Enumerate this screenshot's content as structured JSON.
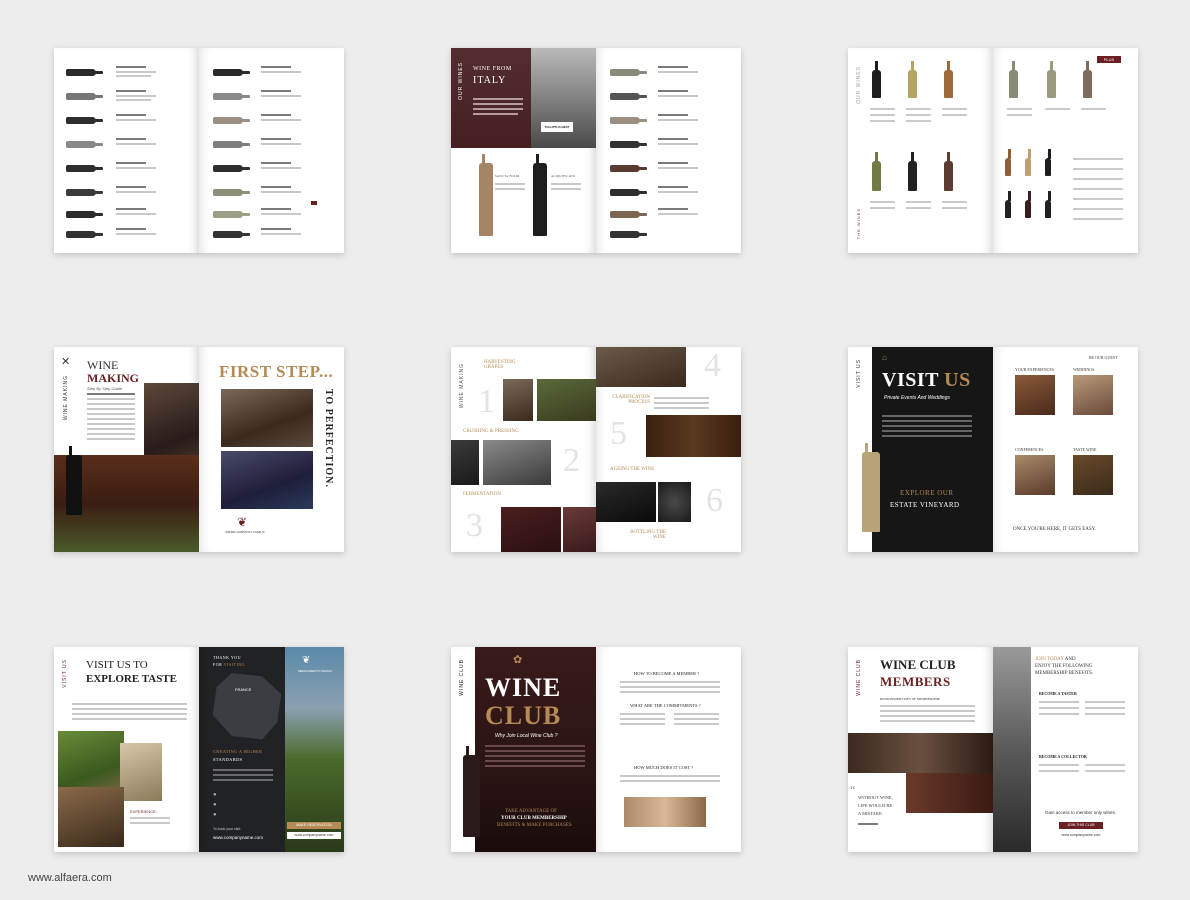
{
  "footer_url": "www.alfaera.com",
  "spread2": {
    "wine_from": "WINE FROM",
    "italy": "ITALY",
    "side_label": "OUR WINES",
    "sticker": "TOLUPTUA DEST",
    "bottle1": "SANCTA FOLIR",
    "bottle2": "ALIQUIFICATO"
  },
  "spread3": {
    "side_label": "OUR WINES",
    "tag": "PLUS",
    "side_label2": "THE WINES"
  },
  "spread4": {
    "title1": "WINE",
    "title2": "MAKING",
    "subtitle": "Step By Step Guide",
    "side_label": "WINE MAKING",
    "first_step": "FIRST STEP...",
    "to_perfection": "TO PERFECTION.",
    "brand": "MEDICAMENTO SAMUS"
  },
  "spread5": {
    "side_label": "WINE MAKING",
    "steps": [
      "HARVESTING GRAPES",
      "CRUSHING & PRESSING",
      "FERMENTATION",
      "CLARIFICATION PROCESS",
      "AGEING THE WINE",
      "BOTTLING THE WINE"
    ],
    "numbers": [
      "1",
      "2",
      "3",
      "4",
      "5",
      "6"
    ]
  },
  "spread6": {
    "side_label": "VISIT US",
    "visit": "VISIT",
    "us": "US",
    "tagline": "Private Events And Weddings",
    "explore": "EXPLORE OUR",
    "estate": "ESTATE VINEYARD",
    "be_our_guest": "BE OUR GUEST",
    "your_experiences": "YOUR EXPERIENCES",
    "weddings": "WEDDINGS",
    "conferences": "CONFERENCES",
    "taste_wine": "TASTE WINE",
    "once": "ONCE YOU'RE HERE, IT GETS EASY."
  },
  "spread7": {
    "side_label": "VISIT US",
    "visit_to": "VISIT US TO",
    "explore_taste": "EXPLORE TASTE",
    "thank_you": "THANK YOU",
    "for": "FOR",
    "visiting": "VISITING",
    "france": "FRANCE",
    "brand": "MEDICAMENTO SAMUS",
    "creating": "CREATING A HIGHER",
    "standards": "STANDARDS",
    "book": "To book your visit:",
    "url1": "www.companyname.com",
    "url2": "www.companyname.com",
    "experience": "EXPERIENCE:",
    "btn": "MAKE RESERVATION"
  },
  "spread8": {
    "side_label": "WINE CLUB",
    "wine": "WINE",
    "club": "CLUB",
    "why": "Why Join Local Wine Club ?",
    "take": "TAKE ADVANTAGE OF",
    "your": "YOUR CLUB MEMBERSHIP",
    "benefits": "BENEFITS & MAKE PURCHASES",
    "q1": "HOW TO BECOME A MEMBER ?",
    "q2": "WHAT ARE THE COMMITMENTS ?",
    "q3": "HOW MUCH DOES IT COST ?"
  },
  "spread9": {
    "side_label": "WINE CLUB",
    "wine_club": "WINE CLUB",
    "members": "MEMBERS",
    "resp": "RESPONSIBILITIES OF MEMBERSHIP",
    "quote1": "WITHOUT WINE,",
    "quote2": "LIFE WOULD BE",
    "quote3": "A MISTAKE.",
    "join1": "JOIN TODAY",
    "join2": "AND",
    "join3": "ENJOY THE FOLLOWING",
    "join4": "MEMBERSHIP BENEFITS.",
    "taster": "BECOME A TASTER",
    "collector": "BECOME A COLLECTOR",
    "gain": "Gain access to member only wines.",
    "btn": "JOIN THIS CLUB",
    "url": "www.companyname.com"
  },
  "colors": {
    "wine": "#6b1f22",
    "gold": "#b58a55",
    "dark": "#1c1c1c",
    "background": "#ededed"
  }
}
